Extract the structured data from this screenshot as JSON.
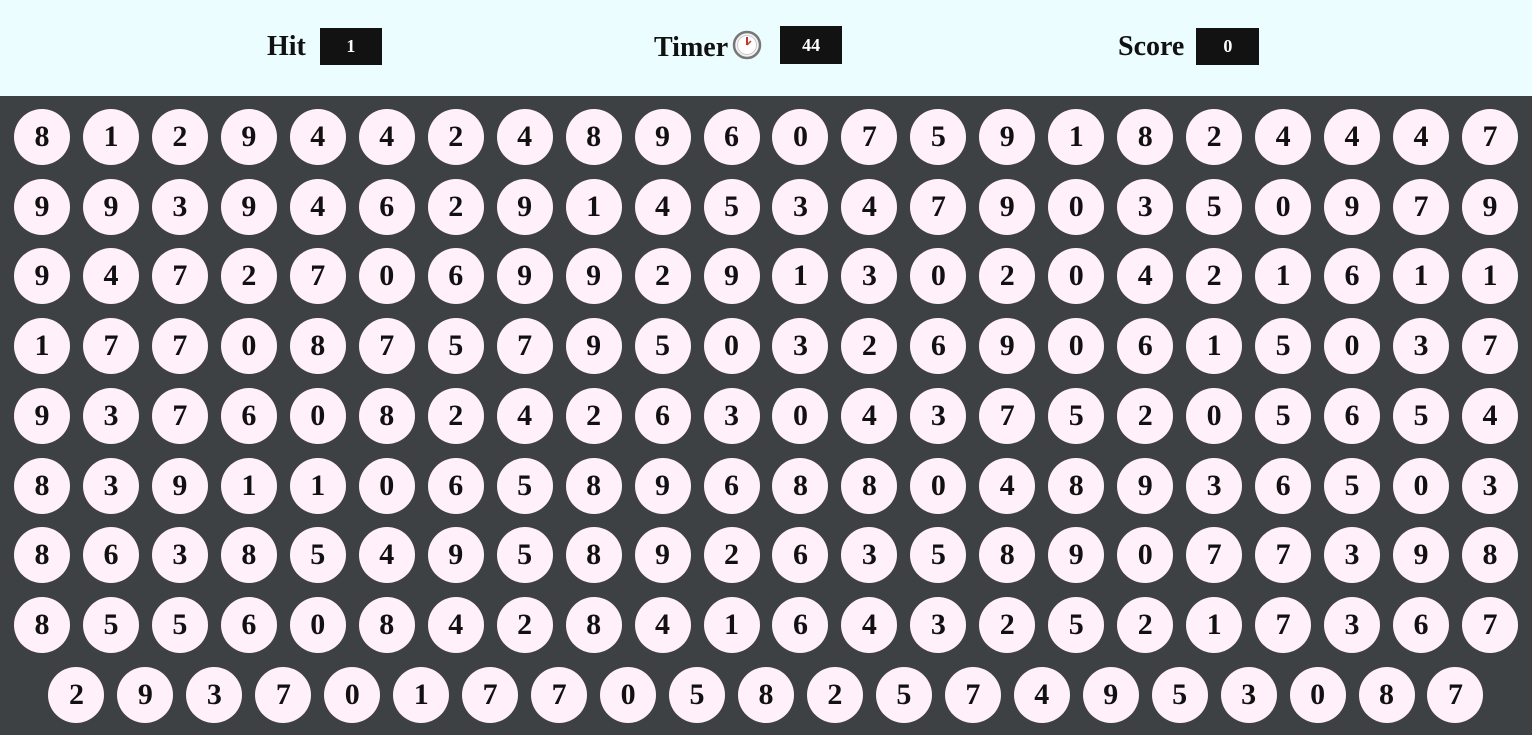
{
  "hud": {
    "hit_label": "Hit",
    "hit_value": "1",
    "timer_label": "Timer",
    "timer_icon": "clock-icon",
    "timer_value": "44",
    "score_label": "Score",
    "score_value": "0"
  },
  "colors": {
    "header_bg": "#ebfdfe",
    "board_bg": "#3e4143",
    "ball_bg": "#fff0fa",
    "value_box_bg": "#121212"
  },
  "board": {
    "rows": [
      [
        "8",
        "1",
        "2",
        "9",
        "4",
        "4",
        "2",
        "4",
        "8",
        "9",
        "6",
        "0",
        "7",
        "5",
        "9",
        "1",
        "8",
        "2",
        "4",
        "4",
        "4",
        "7"
      ],
      [
        "9",
        "9",
        "3",
        "9",
        "4",
        "6",
        "2",
        "9",
        "1",
        "4",
        "5",
        "3",
        "4",
        "7",
        "9",
        "0",
        "3",
        "5",
        "0",
        "9",
        "7",
        "9"
      ],
      [
        "9",
        "4",
        "7",
        "2",
        "7",
        "0",
        "6",
        "9",
        "9",
        "2",
        "9",
        "1",
        "3",
        "0",
        "2",
        "0",
        "4",
        "2",
        "1",
        "6",
        "1",
        "1"
      ],
      [
        "1",
        "7",
        "7",
        "0",
        "8",
        "7",
        "5",
        "7",
        "9",
        "5",
        "0",
        "3",
        "2",
        "6",
        "9",
        "0",
        "6",
        "1",
        "5",
        "0",
        "3",
        "7"
      ],
      [
        "9",
        "3",
        "7",
        "6",
        "0",
        "8",
        "2",
        "4",
        "2",
        "6",
        "3",
        "0",
        "4",
        "3",
        "7",
        "5",
        "2",
        "0",
        "5",
        "6",
        "5",
        "4"
      ],
      [
        "8",
        "3",
        "9",
        "1",
        "1",
        "0",
        "6",
        "5",
        "8",
        "9",
        "6",
        "8",
        "8",
        "0",
        "4",
        "8",
        "9",
        "3",
        "6",
        "5",
        "0",
        "3"
      ],
      [
        "8",
        "6",
        "3",
        "8",
        "5",
        "4",
        "9",
        "5",
        "8",
        "9",
        "2",
        "6",
        "3",
        "5",
        "8",
        "9",
        "0",
        "7",
        "7",
        "3",
        "9",
        "8"
      ],
      [
        "8",
        "5",
        "5",
        "6",
        "0",
        "8",
        "4",
        "2",
        "8",
        "4",
        "1",
        "6",
        "4",
        "3",
        "2",
        "5",
        "2",
        "1",
        "7",
        "3",
        "6",
        "7"
      ],
      [
        "2",
        "9",
        "3",
        "7",
        "0",
        "1",
        "7",
        "7",
        "0",
        "5",
        "8",
        "2",
        "5",
        "7",
        "4",
        "9",
        "5",
        "3",
        "0",
        "8",
        "7"
      ]
    ]
  }
}
